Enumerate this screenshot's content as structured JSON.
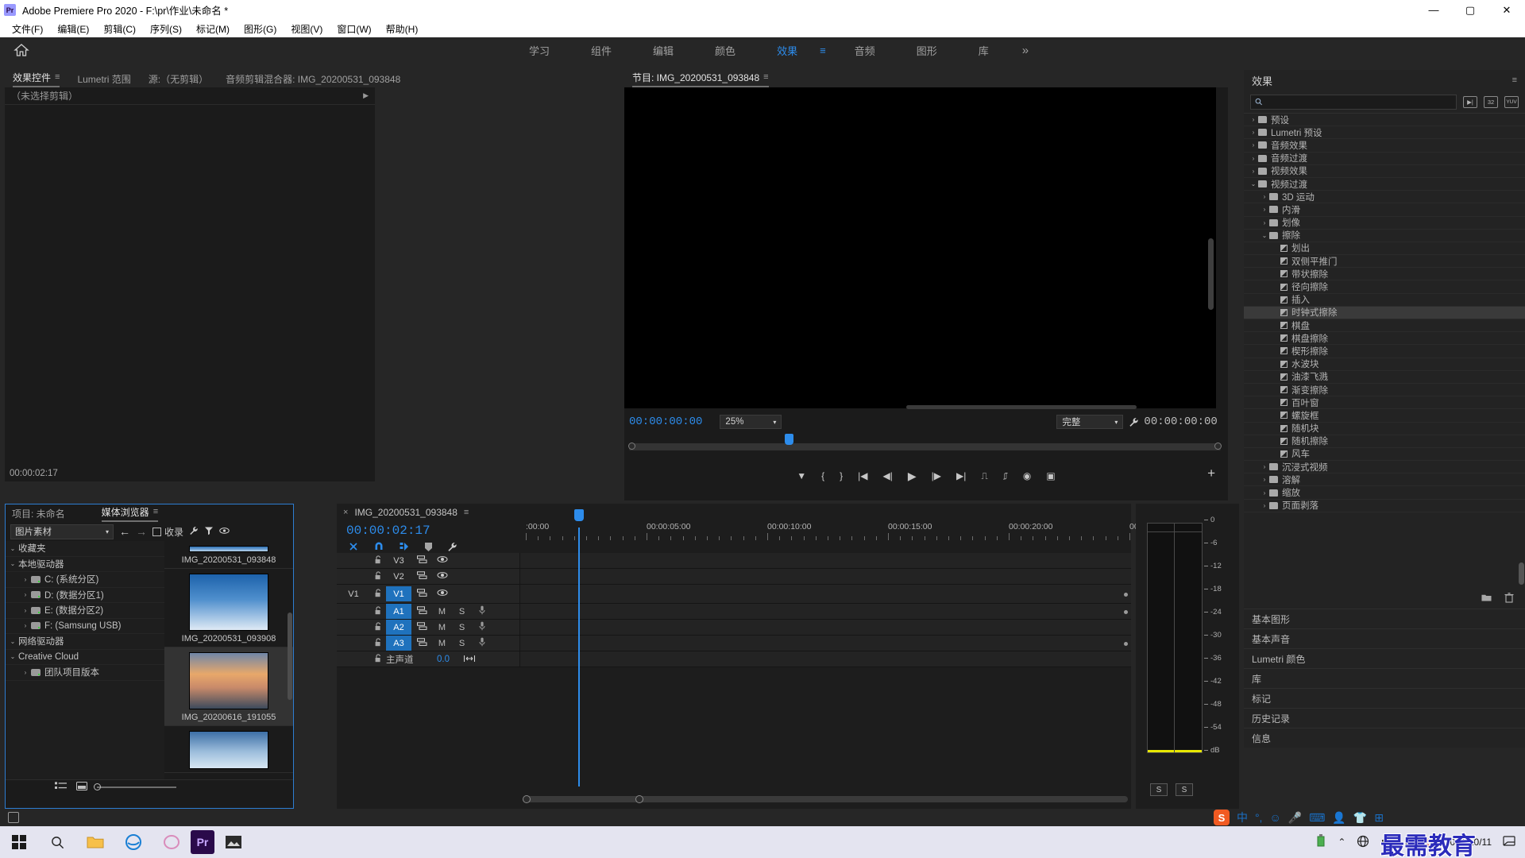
{
  "titlebar": {
    "logo": "Pr",
    "title": "Adobe Premiere Pro 2020 - F:\\pr\\作业\\未命名 *",
    "minimize": "—",
    "maximize": "▢",
    "close": "✕"
  },
  "menubar": {
    "items": [
      "文件(F)",
      "编辑(E)",
      "剪辑(C)",
      "序列(S)",
      "标记(M)",
      "图形(G)",
      "视图(V)",
      "窗口(W)",
      "帮助(H)"
    ]
  },
  "workspace": {
    "home_icon": "home-icon",
    "items": [
      {
        "label": "学习",
        "active": false
      },
      {
        "label": "组件",
        "active": false
      },
      {
        "label": "编辑",
        "active": false
      },
      {
        "label": "颜色",
        "active": false
      },
      {
        "label": "效果",
        "active": true
      },
      {
        "label": "音频",
        "active": false
      },
      {
        "label": "图形",
        "active": false
      },
      {
        "label": "库",
        "active": false
      }
    ],
    "menu_glyph": "≡",
    "overflow": "»"
  },
  "effect_controls": {
    "tabs": [
      {
        "label": "效果控件",
        "active": true,
        "has_menu": true
      },
      {
        "label": "Lumetri 范围",
        "active": false
      },
      {
        "label": "源:（无剪辑）",
        "active": false
      },
      {
        "label": "音频剪辑混合器: IMG_20200531_093848",
        "active": false
      }
    ],
    "empty_text": "（未选择剪辑）",
    "expander": "▶",
    "timecode": "00:00:02:17"
  },
  "program_monitor": {
    "tab_label": "节目: IMG_20200531_093848",
    "menu_glyph": "≡",
    "current_timecode": "00:00:00:00",
    "zoom_level": "25%",
    "resolution": "完整",
    "duration_timecode": "00:00:00:00",
    "wrench_icon": "wrench-icon",
    "buttons": [
      {
        "name": "add-marker-button",
        "glyph": "▼"
      },
      {
        "name": "mark-in-button",
        "glyph": "{"
      },
      {
        "name": "mark-out-button",
        "glyph": "}"
      },
      {
        "name": "go-to-in-button",
        "glyph": "|◀"
      },
      {
        "name": "step-back-button",
        "glyph": "◀|"
      },
      {
        "name": "play-stop-button",
        "glyph": "▶"
      },
      {
        "name": "step-forward-button",
        "glyph": "|▶"
      },
      {
        "name": "go-to-out-button",
        "glyph": "▶|"
      },
      {
        "name": "lift-button",
        "glyph": "⎍"
      },
      {
        "name": "extract-button",
        "glyph": "⎎"
      },
      {
        "name": "export-frame-button",
        "glyph": "◉"
      },
      {
        "name": "comparison-view-button",
        "glyph": "▣"
      }
    ],
    "plus_button": "+"
  },
  "effects_panel": {
    "title": "效果",
    "menu_glyph": "≡",
    "search_placeholder": "",
    "search_value": "",
    "filter_icons": [
      "accelerated-effect-icon",
      "32-bit-color-icon",
      "yuv-icon"
    ],
    "tree": [
      {
        "label": "预设",
        "type": "folder-preset",
        "indent": 0,
        "state": "collapsed"
      },
      {
        "label": "Lumetri 预设",
        "type": "folder-preset",
        "indent": 0,
        "state": "collapsed"
      },
      {
        "label": "音频效果",
        "type": "folder",
        "indent": 0,
        "state": "collapsed"
      },
      {
        "label": "音频过渡",
        "type": "folder",
        "indent": 0,
        "state": "collapsed"
      },
      {
        "label": "视频效果",
        "type": "folder",
        "indent": 0,
        "state": "collapsed"
      },
      {
        "label": "视频过渡",
        "type": "folder",
        "indent": 0,
        "state": "expanded"
      },
      {
        "label": "3D 运动",
        "type": "folder",
        "indent": 1,
        "state": "collapsed"
      },
      {
        "label": "内滑",
        "type": "folder",
        "indent": 1,
        "state": "collapsed"
      },
      {
        "label": "划像",
        "type": "folder",
        "indent": 1,
        "state": "collapsed"
      },
      {
        "label": "擦除",
        "type": "folder",
        "indent": 1,
        "state": "expanded"
      },
      {
        "label": "划出",
        "type": "transition",
        "indent": 2,
        "state": "leaf"
      },
      {
        "label": "双侧平推门",
        "type": "transition",
        "indent": 2,
        "state": "leaf"
      },
      {
        "label": "带状擦除",
        "type": "transition",
        "indent": 2,
        "state": "leaf"
      },
      {
        "label": "径向擦除",
        "type": "transition",
        "indent": 2,
        "state": "leaf"
      },
      {
        "label": "插入",
        "type": "transition",
        "indent": 2,
        "state": "leaf"
      },
      {
        "label": "时钟式擦除",
        "type": "transition",
        "indent": 2,
        "state": "leaf",
        "selected": true
      },
      {
        "label": "棋盘",
        "type": "transition",
        "indent": 2,
        "state": "leaf"
      },
      {
        "label": "棋盘擦除",
        "type": "transition",
        "indent": 2,
        "state": "leaf"
      },
      {
        "label": "楔形擦除",
        "type": "transition",
        "indent": 2,
        "state": "leaf"
      },
      {
        "label": "水波块",
        "type": "transition",
        "indent": 2,
        "state": "leaf"
      },
      {
        "label": "油漆飞溅",
        "type": "transition",
        "indent": 2,
        "state": "leaf"
      },
      {
        "label": "渐变擦除",
        "type": "transition",
        "indent": 2,
        "state": "leaf"
      },
      {
        "label": "百叶窗",
        "type": "transition",
        "indent": 2,
        "state": "leaf"
      },
      {
        "label": "螺旋框",
        "type": "transition",
        "indent": 2,
        "state": "leaf"
      },
      {
        "label": "随机块",
        "type": "transition",
        "indent": 2,
        "state": "leaf"
      },
      {
        "label": "随机擦除",
        "type": "transition",
        "indent": 2,
        "state": "leaf"
      },
      {
        "label": "风车",
        "type": "transition",
        "indent": 2,
        "state": "leaf"
      },
      {
        "label": "沉浸式视频",
        "type": "folder",
        "indent": 1,
        "state": "collapsed"
      },
      {
        "label": "溶解",
        "type": "folder",
        "indent": 1,
        "state": "collapsed"
      },
      {
        "label": "缩放",
        "type": "folder",
        "indent": 1,
        "state": "collapsed"
      },
      {
        "label": "页面剥落",
        "type": "folder",
        "indent": 1,
        "state": "collapsed"
      }
    ],
    "footer_icons": [
      "new-custom-bin-icon",
      "delete-icon"
    ],
    "stacked_panels": [
      "基本图形",
      "基本声音",
      "Lumetri 颜色",
      "库",
      "标记",
      "历史记录",
      "信息"
    ]
  },
  "media_browser": {
    "tabs": [
      {
        "label": "项目: 未命名",
        "active": false
      },
      {
        "label": "媒体浏览器",
        "active": true
      }
    ],
    "menu_glyph": "≡",
    "view_select": "图片素材",
    "nav_back": "←",
    "nav_forward": "→",
    "ingest_label": "收录",
    "toolbar_icons": [
      "wrench-icon",
      "filter-icon",
      "eye-icon"
    ],
    "tree": [
      {
        "label": "收藏夹",
        "indent": 0,
        "state": "expanded",
        "icon": "none"
      },
      {
        "label": "本地驱动器",
        "indent": 0,
        "state": "expanded",
        "icon": "none"
      },
      {
        "label": "C: (系统分区)",
        "indent": 1,
        "state": "collapsed",
        "icon": "system-drive-icon"
      },
      {
        "label": "D: (数据分区1)",
        "indent": 1,
        "state": "collapsed",
        "icon": "drive-icon"
      },
      {
        "label": "E: (数据分区2)",
        "indent": 1,
        "state": "collapsed",
        "icon": "drive-icon"
      },
      {
        "label": "F: (Samsung USB)",
        "indent": 1,
        "state": "collapsed",
        "icon": "drive-icon"
      },
      {
        "label": "网络驱动器",
        "indent": 0,
        "state": "expanded",
        "icon": "none"
      },
      {
        "label": "Creative Cloud",
        "indent": 0,
        "state": "expanded",
        "icon": "none"
      },
      {
        "label": "团队项目版本",
        "indent": 1,
        "state": "collapsed",
        "icon": "team-project-icon"
      }
    ],
    "thumbnails": [
      {
        "label": "IMG_20200531_093848",
        "selected": false,
        "partial": true
      },
      {
        "label": "IMG_20200531_093908",
        "selected": false,
        "partial": false
      },
      {
        "label": "IMG_20200616_191055",
        "selected": true,
        "partial": false
      },
      {
        "label": "",
        "selected": false,
        "partial": true
      }
    ],
    "footer_icons": [
      "list-view-icon",
      "thumbnail-view-icon"
    ],
    "zoom_slider_value": 0
  },
  "timeline": {
    "close_glyph": "×",
    "sequence_name": "IMG_20200531_093848",
    "menu_glyph": "≡",
    "playhead_timecode": "00:00:02:17",
    "tools": [
      "snap-in-timeline-icon",
      "linked-selection-icon",
      "marker-add-icon",
      "marker-icon",
      "wrench-icon"
    ],
    "ruler_labels": [
      ":00:00",
      "00:00:05:00",
      "00:00:10:00",
      "00:00:15:00",
      "00:00:20:00",
      "00:"
    ],
    "tracks": [
      {
        "name": "V3",
        "type": "video",
        "targeted": false,
        "sync_label": "",
        "lock": "🔓",
        "icons": [
          "toggle-track-output-icon",
          "eye-icon"
        ]
      },
      {
        "name": "V2",
        "type": "video",
        "targeted": false,
        "sync_label": "",
        "lock": "🔓",
        "icons": [
          "toggle-track-output-icon",
          "eye-icon"
        ]
      },
      {
        "name": "V1",
        "type": "video",
        "targeted": true,
        "sync_label": "V1",
        "lock": "🔓",
        "icons": [
          "toggle-track-output-icon",
          "eye-icon"
        ]
      },
      {
        "name": "A1",
        "type": "audio",
        "targeted": true,
        "sync_label": "",
        "lock": "🔓",
        "mute": "M",
        "solo": "S",
        "icons": [
          "toggle-track-output-icon",
          "mic-icon"
        ]
      },
      {
        "name": "A2",
        "type": "audio",
        "targeted": true,
        "sync_label": "",
        "lock": "🔓",
        "mute": "M",
        "solo": "S",
        "icons": [
          "toggle-track-output-icon",
          "mic-icon"
        ]
      },
      {
        "name": "A3",
        "type": "audio",
        "targeted": true,
        "sync_label": "",
        "lock": "🔓",
        "mute": "M",
        "solo": "S",
        "icons": [
          "toggle-track-output-icon",
          "mic-icon"
        ]
      }
    ],
    "master_track": {
      "label": "主声道",
      "level": "0.0",
      "meter_icon": "pan-icon"
    }
  },
  "audio_meters": {
    "scale_labels": [
      "0",
      "-6",
      "-12",
      "-18",
      "-24",
      "-30",
      "-36",
      "-42",
      "-48",
      "-54",
      "dB"
    ],
    "solo_buttons": [
      "S",
      "S"
    ],
    "channels": 2
  },
  "taskbar": {
    "start_icon": "windows-start-icon",
    "search_icon": "search-icon",
    "apps": [
      "file-explorer-icon",
      "edge-icon",
      "photoshop-icon",
      "premiere-icon",
      "photos-icon"
    ],
    "tray_icons": [
      "usb-eject-icon",
      "chevron-up-icon",
      "network-icon",
      "volume-icon",
      "ime-chinese-icon",
      "sogou-icon"
    ],
    "clock_date": "2021/10/11",
    "watermark": "最需教育"
  },
  "ime_bar": {
    "sogou": "S",
    "glyphs": [
      "中",
      "°,",
      "☺",
      "🎤",
      "⌨",
      "👤",
      "👕",
      "⊞"
    ]
  },
  "colors": {
    "accent_blue": "#2d8ceb",
    "panel_bg": "#222222",
    "app_bg": "#262626",
    "track_target": "#1f72bd",
    "meter_yellow": "#e8e800"
  }
}
